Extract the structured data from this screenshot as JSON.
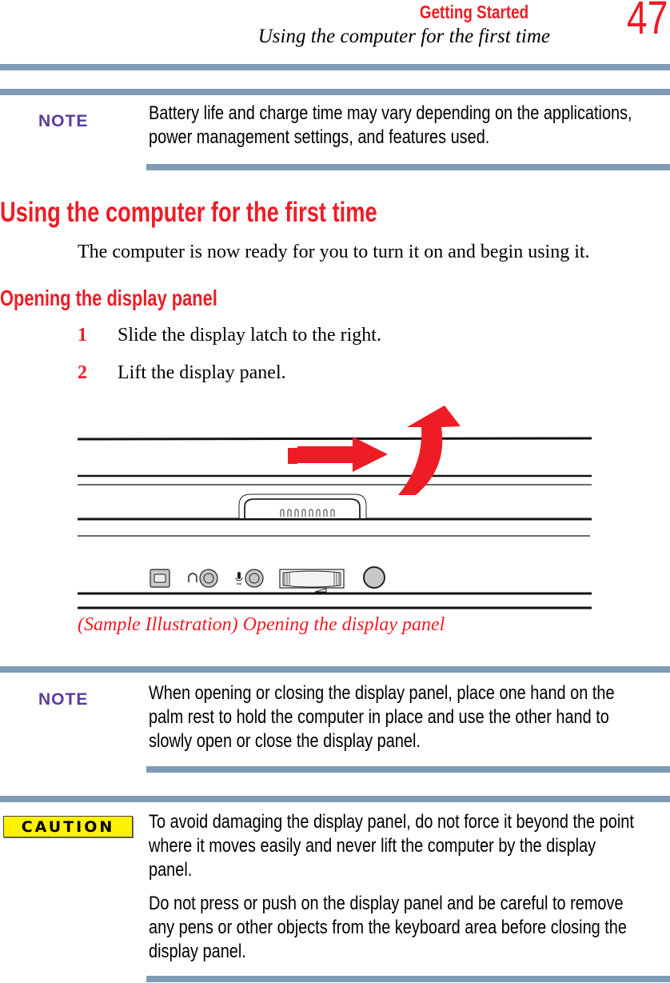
{
  "header": {
    "section": "Getting Started",
    "chapter": "Using the computer for the first time",
    "page_number": "47"
  },
  "note1": {
    "label": "NOTE",
    "lines": [
      "Battery life and charge time may vary depending on the applications,",
      "power management settings, and features used."
    ]
  },
  "section": {
    "heading": "Using the computer for the first time",
    "intro": "The computer is now ready for you to turn it on and begin using it."
  },
  "subsection": {
    "heading": "Opening the display panel",
    "steps": [
      {
        "num": "1",
        "text": "Slide the display latch to the right."
      },
      {
        "num": "2",
        "text": "Lift the display panel."
      }
    ]
  },
  "figure": {
    "caption": "(Sample Illustration) Opening the display panel",
    "accent_color": "#ee1c25"
  },
  "note2": {
    "label": "NOTE",
    "lines": [
      "When opening or closing the display panel, place one hand on the",
      "palm rest to hold the computer in place and use the other hand to",
      "slowly open or close the display panel."
    ]
  },
  "caution": {
    "label": "CAUTION",
    "para1": [
      "To avoid damaging the display panel, do not force it beyond the point",
      "where it moves easily and never lift the computer by the display",
      "panel."
    ],
    "para2": [
      "Do not press or push on the display panel and be careful to remove",
      "any pens or other objects from the keyboard area before closing the",
      "display panel."
    ]
  },
  "colors": {
    "heading_red": "#ee1c25",
    "note_purple": "#5b3c9d",
    "rule_blue": "#7f9bb5",
    "caution_yellow": "#fff200"
  }
}
